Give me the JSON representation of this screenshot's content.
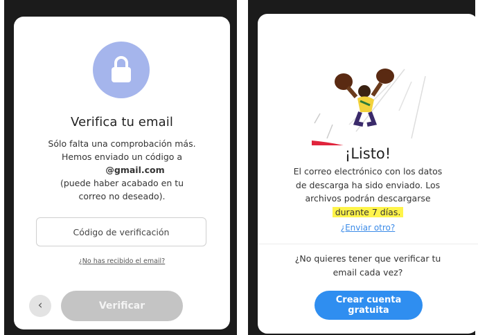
{
  "verify": {
    "title": "Verifica tu email",
    "line1": "Sólo falta una comprobación más.",
    "line2": "Hemos enviado un código a",
    "email": "@gmail.com",
    "line3": "(puede haber acabado en tu",
    "line4": "correo no deseado).",
    "code_placeholder": "Código de verificación",
    "no_email_link": "¿No has recibido el email?",
    "back_icon": "chevron-left-icon",
    "verify_button": "Verificar",
    "lock_icon": "lock-icon",
    "accent_color": "#a5b5ec"
  },
  "done": {
    "title": "¡Listo!",
    "line1": "El correo electrónico con los datos",
    "line2": "de descarga ha sido enviado. Los",
    "line3": "archivos podrán descargarse",
    "highlight": "durante 7 días.",
    "send_another": "¿Enviar otro?",
    "question_line1": "¿No quieres tener que verificar tu",
    "question_line2": "email cada vez?",
    "create_line1": "Crear cuenta",
    "create_line2": "gratuita",
    "button_color": "#2f8ef0",
    "highlight_color": "#fff44a"
  }
}
